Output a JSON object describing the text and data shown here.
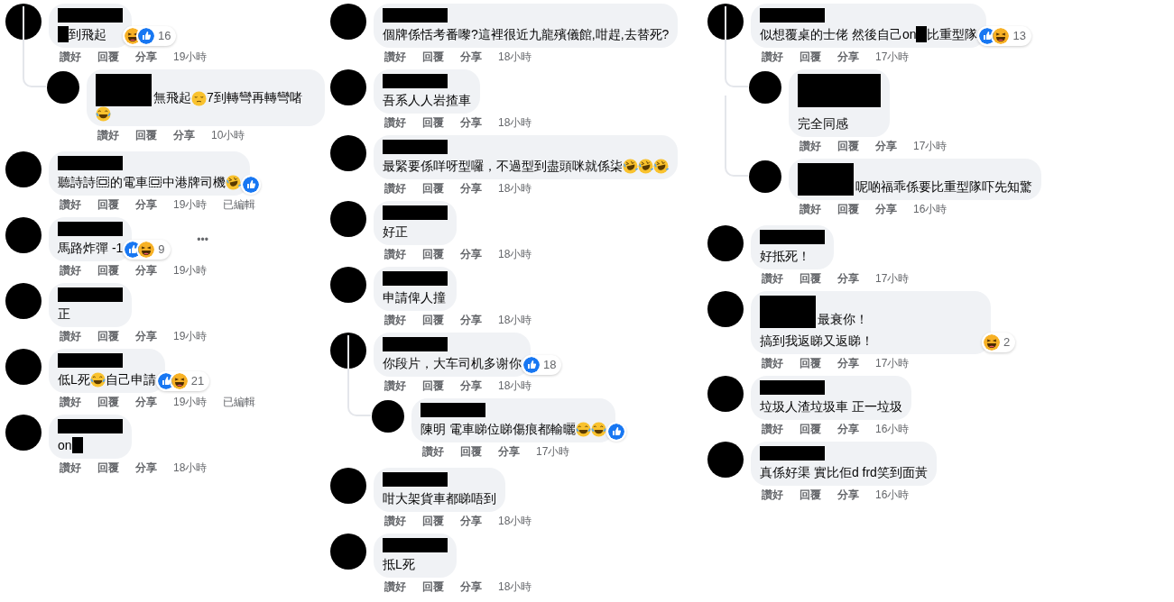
{
  "columns": [
    {
      "comments": [
        {
          "body": [
            {
              "kind": "redacted"
            },
            {
              "kind": "text",
              "text": "到飛起"
            }
          ],
          "reactions": {
            "icons": [
              {
                "kind": "haha"
              },
              {
                "kind": "like"
              }
            ],
            "count": "16"
          },
          "actions": [
            "讚好",
            "回覆",
            "分享"
          ],
          "time": "19小時",
          "replies": [
            {
              "body": [
                {
                  "kind": "name-inline"
                },
                {
                  "kind": "text",
                  "text": "無飛起"
                },
                {
                  "kind": "pensive"
                },
                {
                  "kind": "text",
                  "text": "7到轉彎再轉彎啫"
                },
                {
                  "kind": "joy"
                }
              ],
              "actions": [
                "讚好",
                "回覆",
                "分享"
              ],
              "time": "10小時"
            }
          ]
        },
        {
          "body": [
            {
              "kind": "text",
              "text": "聽詩詩"
            },
            {
              "kind": "object"
            },
            {
              "kind": "text",
              "text": "的電車"
            },
            {
              "kind": "object"
            },
            {
              "kind": "text",
              "text": "中港牌司機"
            },
            {
              "kind": "rofl"
            }
          ],
          "reactions": {
            "icons": [
              {
                "kind": "like"
              }
            ]
          },
          "actions": [
            "讚好",
            "回覆",
            "分享"
          ],
          "time": "19小時",
          "edited": "已編輯"
        },
        {
          "body": [
            {
              "kind": "text",
              "text": "馬路炸彈 -1"
            }
          ],
          "reactions": {
            "icons": [
              {
                "kind": "like"
              },
              {
                "kind": "haha"
              }
            ],
            "count": "9"
          },
          "more": "•••",
          "actions": [
            "讚好",
            "回覆",
            "分享"
          ],
          "time": "19小時"
        },
        {
          "body": [
            {
              "kind": "text",
              "text": "正"
            }
          ],
          "actions": [
            "讚好",
            "回覆",
            "分享"
          ],
          "time": "19小時"
        },
        {
          "body": [
            {
              "kind": "text",
              "text": "低L死"
            },
            {
              "kind": "joy"
            },
            {
              "kind": "text",
              "text": "自己申請"
            }
          ],
          "reactions": {
            "icons": [
              {
                "kind": "like"
              },
              {
                "kind": "haha"
              }
            ],
            "count": "21"
          },
          "actions": [
            "讚好",
            "回覆",
            "分享"
          ],
          "time": "19小時",
          "edited": "已編輯"
        },
        {
          "body": [
            {
              "kind": "text",
              "text": "on"
            },
            {
              "kind": "redacted"
            }
          ],
          "actions": [
            "讚好",
            "回覆",
            "分享"
          ],
          "time": "18小時"
        }
      ]
    },
    {
      "comments": [
        {
          "body": [
            {
              "kind": "text",
              "text": "個牌係恬考番嚟?這裡很近九龍殯儀館,咁趕,去替死?"
            }
          ],
          "actions": [
            "讚好",
            "回覆",
            "分享"
          ],
          "time": "18小時"
        },
        {
          "body": [
            {
              "kind": "text",
              "text": "吾系人人岩揸車"
            }
          ],
          "actions": [
            "讚好",
            "回覆",
            "分享"
          ],
          "time": "18小時"
        },
        {
          "body": [
            {
              "kind": "text",
              "text": "最緊要係咩呀型囉，不過型到盡頭咪就係柒"
            },
            {
              "kind": "rofl"
            },
            {
              "kind": "rofl"
            },
            {
              "kind": "rofl"
            }
          ],
          "actions": [
            "讚好",
            "回覆",
            "分享"
          ],
          "time": "18小時"
        },
        {
          "body": [
            {
              "kind": "text",
              "text": "好正"
            }
          ],
          "actions": [
            "讚好",
            "回覆",
            "分享"
          ],
          "time": "18小時"
        },
        {
          "body": [
            {
              "kind": "text",
              "text": "申請俾人撞"
            }
          ],
          "actions": [
            "讚好",
            "回覆",
            "分享"
          ],
          "time": "18小時"
        },
        {
          "body": [
            {
              "kind": "text",
              "text": "你段片，大车司机多谢你"
            }
          ],
          "reactions": {
            "icons": [
              {
                "kind": "like"
              }
            ],
            "count": "18"
          },
          "actions": [
            "讚好",
            "回覆",
            "分享"
          ],
          "time": "18小時",
          "replies": [
            {
              "body": [
                {
                  "kind": "text",
                  "text": "陳明 電車睇位睇傷痕都輸曬"
                },
                {
                  "kind": "joy"
                },
                {
                  "kind": "joy"
                }
              ],
              "reactions": {
                "icons": [
                  {
                    "kind": "like"
                  }
                ]
              },
              "actions": [
                "讚好",
                "回覆",
                "分享"
              ],
              "time": "17小時"
            }
          ]
        },
        {
          "body": [
            {
              "kind": "text",
              "text": "咁大架貨車都睇唔到"
            }
          ],
          "actions": [
            "讚好",
            "回覆",
            "分享"
          ],
          "time": "18小時"
        },
        {
          "body": [
            {
              "kind": "text",
              "text": "抵L死"
            }
          ],
          "actions": [
            "讚好",
            "回覆",
            "分享"
          ],
          "time": "18小時"
        }
      ]
    },
    {
      "comments": [
        {
          "body": [
            {
              "kind": "text",
              "text": "似想覆桌的士佬 然後自己on"
            },
            {
              "kind": "redacted"
            },
            {
              "kind": "text",
              "text": "比重型隊"
            }
          ],
          "reactions": {
            "icons": [
              {
                "kind": "like"
              },
              {
                "kind": "haha"
              }
            ],
            "count": "13"
          },
          "actions": [
            "讚好",
            "回覆",
            "分享"
          ],
          "time": "17小時",
          "replies": [
            {
              "body": [
                {
                  "kind": "name-tall"
                },
                {
                  "kind": "text",
                  "text": "完全同感"
                }
              ],
              "actions": [
                "讚好",
                "回覆",
                "分享"
              ],
              "time": "17小時"
            },
            {
              "body": [
                {
                  "kind": "name-inline"
                },
                {
                  "kind": "text",
                  "text": "呢啲福乖係要比重型隊吓先知驚"
                }
              ],
              "actions": [
                "讚好",
                "回覆",
                "分享"
              ],
              "time": "16小時"
            }
          ]
        },
        {
          "body": [
            {
              "kind": "text",
              "text": "好抵死！"
            }
          ],
          "actions": [
            "讚好",
            "回覆",
            "分享"
          ],
          "time": "17小時"
        },
        {
          "body": [
            {
              "kind": "name-inline"
            },
            {
              "kind": "text",
              "text": "最衰你！"
            },
            {
              "kind": "break"
            },
            {
              "kind": "text",
              "text": "搞到我返睇又返睇！"
            }
          ],
          "reactions": {
            "icons": [
              {
                "kind": "haha"
              }
            ],
            "count": "2"
          },
          "actions": [
            "讚好",
            "回覆",
            "分享"
          ],
          "time": "17小時"
        },
        {
          "body": [
            {
              "kind": "text",
              "text": "垃圾人渣垃圾車 正一垃圾"
            }
          ],
          "actions": [
            "讚好",
            "回覆",
            "分享"
          ],
          "time": "16小時"
        },
        {
          "body": [
            {
              "kind": "text",
              "text": "真係好渠 實比佢d frd笑到面黃"
            }
          ],
          "actions": [
            "讚好",
            "回覆",
            "分享"
          ],
          "time": "16小時"
        }
      ]
    }
  ]
}
